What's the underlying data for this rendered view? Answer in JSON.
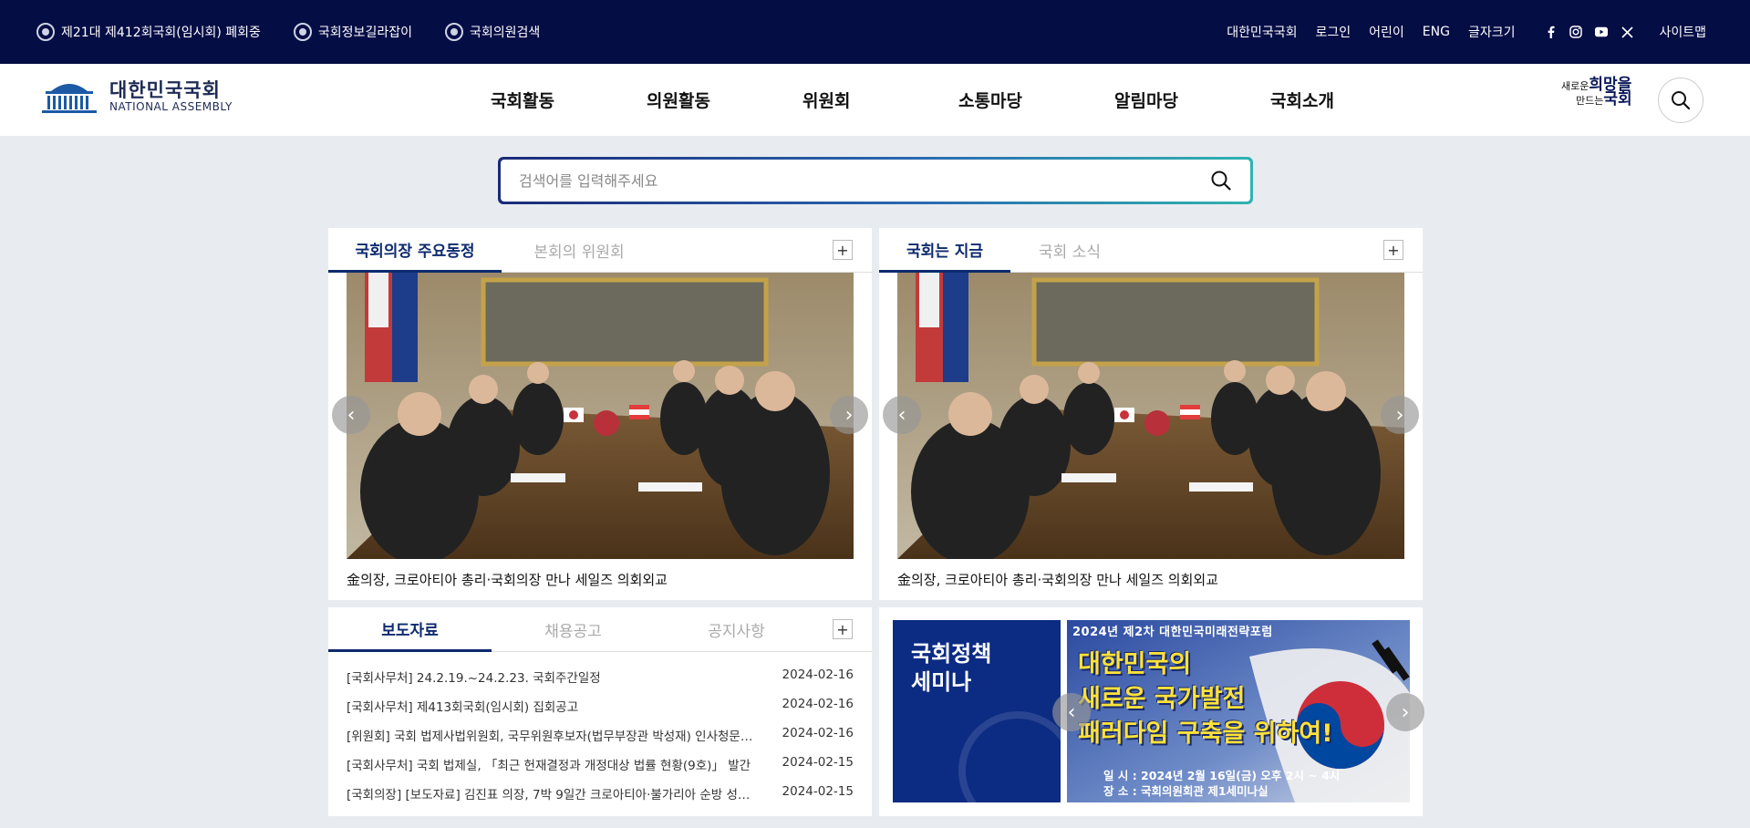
{
  "utility_bar": {
    "session_status": "제21대 제412회국회(임시회) 폐회중",
    "info_guide": "국회정보길라잡이",
    "member_search": "국회의원검색",
    "links": [
      "대한민국국회",
      "로그인",
      "어린이",
      "ENG",
      "글자크기"
    ],
    "socials": [
      "facebook-icon",
      "instagram-icon",
      "youtube-icon",
      "x-icon"
    ],
    "sitemap": "사이트맵"
  },
  "header": {
    "logo_ko": "대한민국국회",
    "logo_en": "NATIONAL ASSEMBLY",
    "menu": [
      "국회활동",
      "의원활동",
      "위원회",
      "소통마당",
      "알림마당",
      "국회소개"
    ],
    "slogan_line1": "새로운",
    "slogan_hope": "희망을",
    "slogan_line2": "만드는",
    "slogan_assembly": "국회"
  },
  "search": {
    "placeholder": "검색어를 입력해주세요"
  },
  "panel_speaker": {
    "tabs": [
      "국회의장 주요동정",
      "본회의 위원회"
    ],
    "caption": "金의장, 크로아티아 총리·국회의장 만나 세일즈 의회외교"
  },
  "panel_now": {
    "tabs": [
      "국회는 지금",
      "국회 소식"
    ],
    "caption": "金의장, 크로아티아 총리·국회의장 만나 세일즈 의회외교"
  },
  "panel_press": {
    "tabs": [
      "보도자료",
      "채용공고",
      "공지사항"
    ],
    "items": [
      {
        "title": "[국회사무처] 24.2.19.~24.2.23. 국회주간일정",
        "date": "2024-02-16"
      },
      {
        "title": "[국회사무처] 제413회국회(임시회) 집회공고",
        "date": "2024-02-16"
      },
      {
        "title": "[위원회] 국회 법제사법위원회, 국무위원후보자(법무부장관 박성재) 인사청문…",
        "date": "2024-02-16"
      },
      {
        "title": "[국회사무처] 국회 법제실, 「최근 헌재결정과 개정대상 법률 현황(9호)」 발간",
        "date": "2024-02-15"
      },
      {
        "title": "[국회의장] [보도자료] 김진표 의장, 7박 9일간 크로아티아·불가리아 순방 성…",
        "date": "2024-02-15"
      }
    ]
  },
  "panel_seminar": {
    "title_line1": "국회정책",
    "title_line2": "세미나",
    "banner_top": "2024년 제2차 대한민국미래전략포럼",
    "banner_line1": "대한민국의",
    "banner_line2": "새로운 국가발전",
    "banner_line3": "패러다임 구축을 위하여!",
    "banner_date": "일 시 : 2024년 2월 16일(금) 오후 2시 ~ 4시",
    "banner_place": "장 소 : 국회의원회관 제1세미나실"
  },
  "colors": {
    "topbar": "#050d45",
    "accent": "#0d2a6e",
    "background": "#e8ecf1"
  }
}
